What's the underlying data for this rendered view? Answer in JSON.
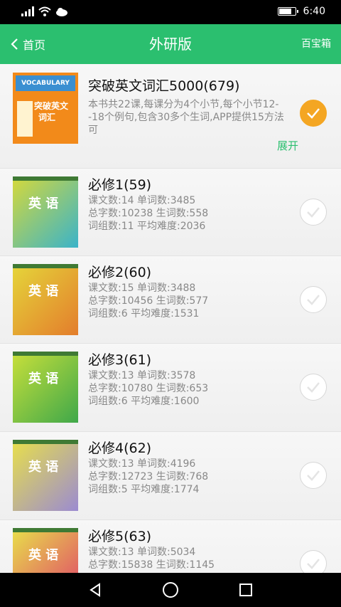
{
  "status_bar": {
    "time": "6:40",
    "battery_level": 0.85
  },
  "app_bar": {
    "back_label": "首页",
    "title": "外研版",
    "right_label": "百宝箱"
  },
  "books": [
    {
      "title": "突破英文词汇5000(679)",
      "description": "本书共22课,每课分为4个小节,每个小节12--18个例句,包含30多个生词,APP提供15方法可",
      "expand_label": "展开",
      "selected": true,
      "cover_words": [
        "VOCABULARY",
        "突破英文",
        "词汇"
      ]
    },
    {
      "title": "必修1(59)",
      "stats": [
        "课文数:14 单词数:3485",
        "总字数:10238 生词数:558",
        "词组数:11 平均难度:2036"
      ],
      "selected": false,
      "cover_word": "英 语"
    },
    {
      "title": "必修2(60)",
      "stats": [
        "课文数:15 单词数:3488",
        "总字数:10456 生词数:577",
        "词组数:6 平均难度:1531"
      ],
      "selected": false,
      "cover_word": "英 语"
    },
    {
      "title": "必修3(61)",
      "stats": [
        "课文数:13 单词数:3578",
        "总字数:10780 生词数:653",
        "词组数:6 平均难度:1600"
      ],
      "selected": false,
      "cover_word": "英 语"
    },
    {
      "title": "必修4(62)",
      "stats": [
        "课文数:13 单词数:4196",
        "总字数:12723 生词数:768",
        "词组数:5 平均难度:1774"
      ],
      "selected": false,
      "cover_word": "英 语"
    },
    {
      "title": "必修5(63)",
      "stats": [
        "课文数:13 单词数:5034",
        "总字数:15838 生词数:1145"
      ],
      "selected": false,
      "cover_word": "英 语"
    }
  ],
  "colors": {
    "accent": "#2bbf6f",
    "selected": "#f4a623"
  }
}
